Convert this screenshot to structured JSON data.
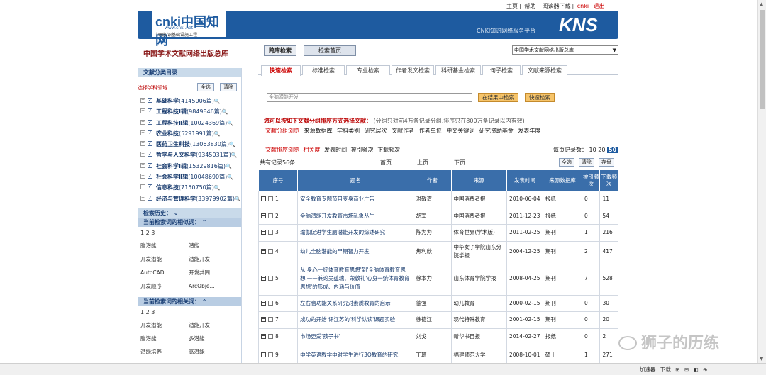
{
  "header": {
    "toplinks": [
      "主页",
      "帮助",
      "阅读器下载",
      "cnki",
      "退出"
    ],
    "logo_main": "cnki中国知网",
    "logo_url": "www.cnki.net",
    "logo_cn": "中国知识基础设施工程",
    "subtitle": "CNKI知识网络服务平台",
    "kns": "KNS",
    "brand_color": "#1e5ba0"
  },
  "nav": {
    "db_title": "中国学术文献网络出版总库",
    "btn_search": "跨库检索",
    "btn_home": "检索首页",
    "db_select": "中国学术文献网络出版总库"
  },
  "sidebar": {
    "class_title": "文献分类目录",
    "pick_label": "选择学科领域",
    "select_all": "全选",
    "clear": "清除",
    "categories": [
      {
        "name": "基础科学",
        "count": "(4145006篇)"
      },
      {
        "name": "工程科技Ⅰ辑",
        "count": "(9849846篇)"
      },
      {
        "name": "工程科技Ⅱ辑",
        "count": "(10024369篇)"
      },
      {
        "name": "农业科技",
        "count": "(5291991篇)"
      },
      {
        "name": "医药卫生科技",
        "count": "(13063830篇)"
      },
      {
        "name": "哲学与人文科学",
        "count": "(9345031篇)"
      },
      {
        "name": "社会科学Ⅰ辑",
        "count": "(15329816篇)"
      },
      {
        "name": "社会科学Ⅱ辑",
        "count": "(10048690篇)"
      },
      {
        "name": "信息科技",
        "count": "(7150750篇)"
      },
      {
        "name": "经济与管理科学",
        "count": "(33979902篇)"
      }
    ],
    "history": "检索历史：",
    "similar_title": "当前检索词的相似词：",
    "similar_pages": "1 2 3",
    "similar_words": [
      "脑潜能",
      "潜能",
      "开发潜能",
      "潜能开发",
      "AutoCAD...",
      "开发共同",
      "开发顺序",
      "ArcObje..."
    ],
    "related_title": "当前检索词的相关词：",
    "related_pages": "1 2 3",
    "related_words": [
      "开发潜能",
      "潜能开发",
      "脑潜能",
      "多潜能",
      "潜能培养",
      "高潜能"
    ]
  },
  "main": {
    "tabs": [
      "快速检索",
      "标准检索",
      "专业检索",
      "作者发文检索",
      "科研基金检索",
      "句子检索",
      "文献来源检索"
    ],
    "search_value": "全脑潜能开发",
    "btn_in_results": "在结果中检索",
    "btn_quick": "快速检索",
    "group_bold": "您可以按如下文献分组排序方式选择文献：",
    "group_note": "(分组只对前4万条记录分组,排序只在800万条记录以内有效)",
    "group_options": [
      "文献分组浏览",
      "来源数据库",
      "学科类别",
      "研究层次",
      "文献作者",
      "作者单位",
      "中文关键词",
      "研究资助基金",
      "发表年度"
    ],
    "sort_options": [
      "文献排序浏览",
      "相关度",
      "发表时间",
      "被引频次",
      "下载频次"
    ],
    "per_page_label": "每页记录数：",
    "per_page": [
      "10",
      "20",
      "50"
    ],
    "total": "共有记录56条",
    "first": "首页",
    "prev": "上页",
    "next": "下页",
    "btn_all": "全选",
    "btn_clear": "清除",
    "btn_save": "存盘"
  },
  "table": {
    "headers": [
      "序号",
      "题名",
      "作者",
      "来源",
      "发表时间",
      "来源数据库",
      "被引频次",
      "下载频次"
    ],
    "rows": [
      {
        "no": "1",
        "title": "安全教育专题节目变身商业广告",
        "author": "洪敬谱",
        "source": "中国消费者报",
        "date": "2010-06-04",
        "db": "报纸",
        "cited": "0",
        "dl": "11"
      },
      {
        "no": "2",
        "title": "全脑潜能开发教育市场乱象丛生",
        "author": "胡军",
        "source": "中国消费者报",
        "date": "2011-12-23",
        "db": "报纸",
        "cited": "0",
        "dl": "54"
      },
      {
        "no": "3",
        "title": "瑜伽促进学生脑潜能开发的综述研究",
        "author": "陈为为",
        "source": "体育世界(学术版)",
        "date": "2011-02-25",
        "db": "期刊",
        "cited": "1",
        "dl": "216"
      },
      {
        "no": "4",
        "title": "幼儿全脑潜能的早期智力开发",
        "author": "焦利欣",
        "source": "中华女子学院山东分院学报",
        "date": "2004-12-25",
        "db": "期刊",
        "cited": "2",
        "dl": "417"
      },
      {
        "no": "5",
        "title": "从'身心一统体育教育思想'到'全脑体育教育思想'——兼论吴蕴瑞、荣敦礼'心身一统体育教育思想'的形成、内涵与价值",
        "author": "徐本力",
        "source": "山东体育学院学报",
        "date": "2008-04-25",
        "db": "期刊",
        "cited": "7",
        "dl": "528"
      },
      {
        "no": "6",
        "title": "左右脑功能关系研究对素质教育的启示",
        "author": "德强",
        "source": "幼儿教育",
        "date": "2000-02-15",
        "db": "期刊",
        "cited": "0",
        "dl": "30"
      },
      {
        "no": "7",
        "title": "成功的开始 评江苏的'科学认读'课题实验",
        "author": "徐德江",
        "source": "现代特殊教育",
        "date": "2001-02-15",
        "db": "期刊",
        "cited": "0",
        "dl": "20"
      },
      {
        "no": "8",
        "title": "市场更爱'孩子书'",
        "author": "刘戈",
        "source": "新华书目报",
        "date": "2014-02-27",
        "db": "报纸",
        "cited": "0",
        "dl": "2"
      },
      {
        "no": "9",
        "title": "中学英语教学中对学生进行3Q教育的研究",
        "author": "丁琼",
        "source": "福建师范大学",
        "date": "2008-10-01",
        "db": "硕士",
        "cited": "1",
        "dl": "271"
      }
    ]
  },
  "status": {
    "items": [
      "加速器",
      "下载",
      "",
      "",
      "",
      ""
    ]
  },
  "watermark": "狮子的历练"
}
